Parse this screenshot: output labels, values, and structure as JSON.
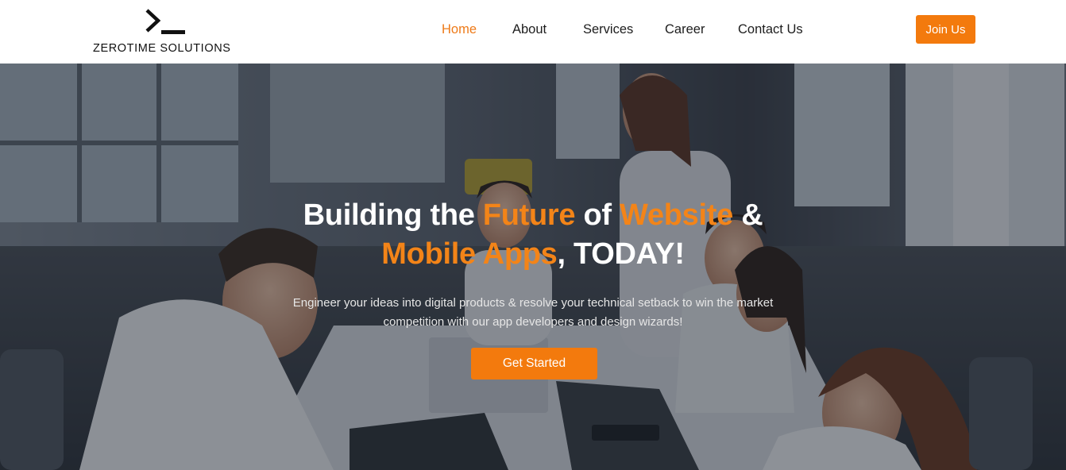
{
  "brand": {
    "name": "ZEROTIME SOLUTIONS",
    "logo_icon": "terminal-prompt-icon"
  },
  "nav": {
    "items": [
      {
        "label": "Home",
        "active": true
      },
      {
        "label": "About"
      },
      {
        "label": "Services"
      },
      {
        "label": "Career"
      },
      {
        "label": "Contact Us"
      }
    ],
    "join_label": "Join Us"
  },
  "hero": {
    "headline_line1": {
      "part1": "Building the ",
      "accent1": "Future",
      "part2": " of ",
      "accent2": "Website",
      "part3": " &"
    },
    "headline_line2": {
      "accent": "Mobile Apps",
      "rest": ", TODAY!"
    },
    "subtitle_line1": "Engineer your ideas into digital products & resolve your technical setback to win the market",
    "subtitle_line2": "competition with our app developers and design wizards!",
    "cta_label": "Get Started",
    "background_image": "team-meeting-office-photo"
  },
  "colors": {
    "accent": "#f37a0d",
    "text_dark": "#1d1d1d",
    "hero_text": "#ffffff"
  }
}
